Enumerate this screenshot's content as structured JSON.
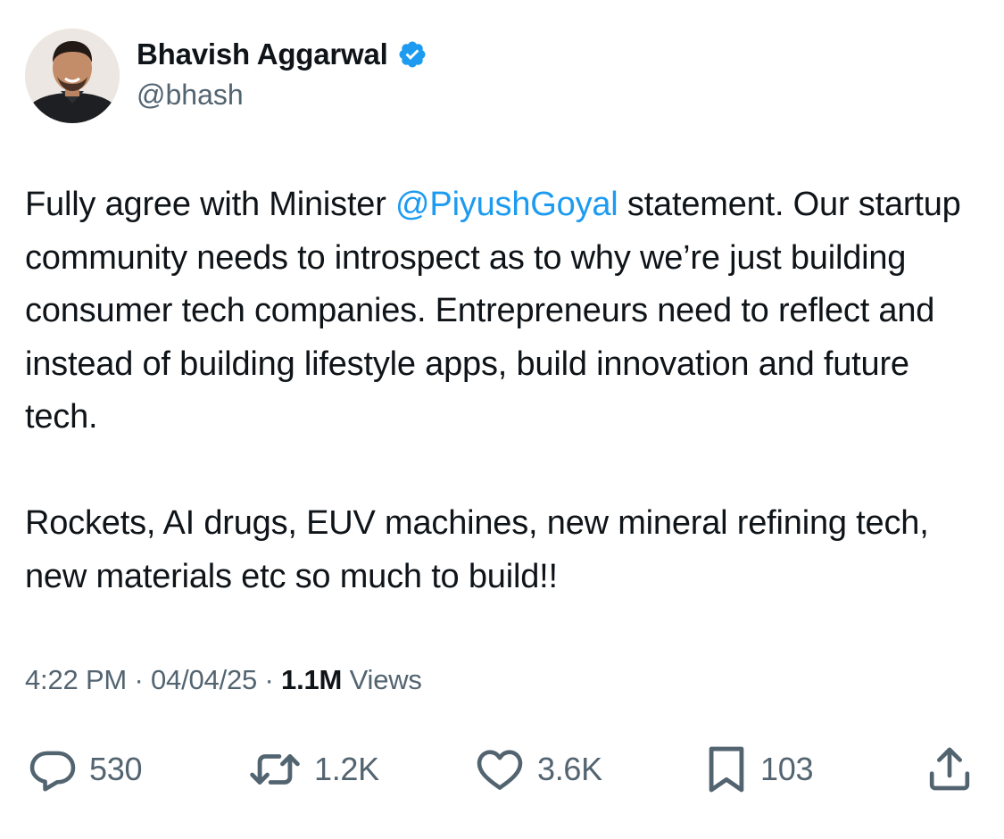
{
  "author": {
    "name": "Bhavish Aggarwal",
    "handle": "@bhash",
    "verified": true,
    "avatar_icon": "profile-photo"
  },
  "tweet": {
    "paragraph1": {
      "before_mention": "Fully agree with Minister ",
      "mention": "@PiyushGoyal",
      "after_mention": " statement. Our startup community needs to introspect as to why we’re just building consumer tech companies. Entrepreneurs need to reflect and instead of building lifestyle apps, build innovation and future tech."
    },
    "paragraph2": "Rockets, AI drugs, EUV machines, new mineral refining tech, new materials etc so much to build!!"
  },
  "meta": {
    "time": "4:22 PM",
    "sep1": " · ",
    "date": "04/04/25",
    "sep2": " · ",
    "views_count": "1.1M",
    "views_label": " Views"
  },
  "actions": {
    "reply_count": "530",
    "repost_count": "1.2K",
    "like_count": "3.6K",
    "bookmark_count": "103"
  },
  "colors": {
    "text": "#0f1419",
    "secondary": "#536471",
    "accent": "#1d9bf0"
  }
}
